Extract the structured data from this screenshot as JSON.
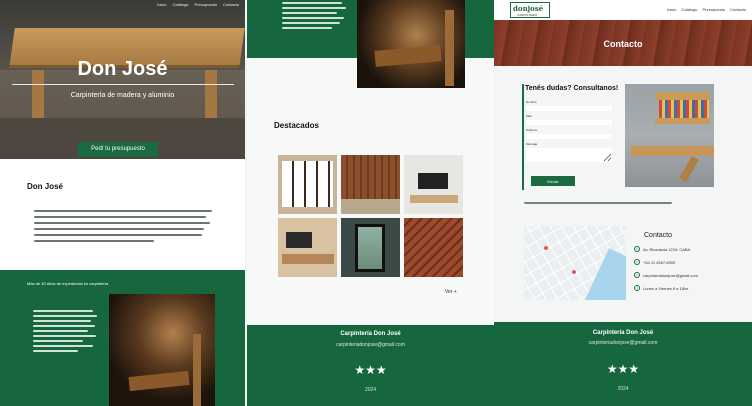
{
  "home": {
    "nav": [
      "Inicio",
      "Catálogo",
      "Presupuesto",
      "Contacto"
    ],
    "hero_title": "Don José",
    "hero_subtitle": "Carpintería de madera y aluminio",
    "cta_label": "Pedí tu presupuesto",
    "about_title": "Don José",
    "green_title": "Más de 30 años de experiencia en carpintería"
  },
  "catalog": {
    "featured_title": "Destacados",
    "more_label": "Ver +",
    "footer": {
      "name": "Carpintería Don José",
      "email": "carpinteriadonjose@gmail.com",
      "stars": "★★★",
      "year": "2024"
    }
  },
  "contact": {
    "logo_text": "donjosé",
    "logo_sub": "CARPINTERÍA",
    "nav": [
      "Inicio",
      "Catálogo",
      "Presupuesto",
      "Contacto"
    ],
    "hero_title": "Contacto",
    "form_title": "Tenés dudas? Consultanos!",
    "form_labels": [
      "Nombre",
      "Mail",
      "Teléfono",
      "Mensaje"
    ],
    "send_label": "Enviar",
    "contact_title": "Contacto",
    "contact_items": [
      {
        "icon": "pin-icon",
        "text": "Av. Rivadavia 1234, CABA"
      },
      {
        "icon": "phone-icon",
        "text": "+54 11 4567-8900"
      },
      {
        "icon": "mail-icon",
        "text": "carpinteriadonjose@gmail.com"
      },
      {
        "icon": "clock-icon",
        "text": "Lunes a Viernes 8 a 18hs"
      }
    ],
    "footer": {
      "name": "Carpintería Don José",
      "email": "carpinteriadonjose@gmail.com",
      "stars": "★★★",
      "year": "2024"
    }
  },
  "colors": {
    "brand_green": "#17673e",
    "deck_red": "#8a3c29"
  }
}
